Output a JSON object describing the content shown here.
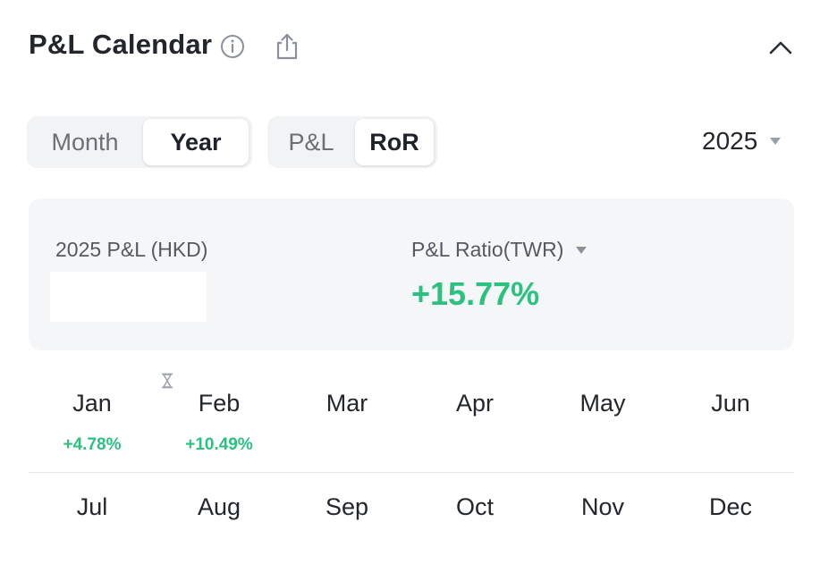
{
  "header": {
    "title": "P&L Calendar",
    "icons": {
      "info": "info-icon",
      "share": "share-icon",
      "collapse": "chevron-up-icon"
    }
  },
  "period_toggle": {
    "options": [
      "Month",
      "Year"
    ],
    "selected": "Year"
  },
  "metric_toggle": {
    "options": [
      "P&L",
      "RoR"
    ],
    "selected": "RoR"
  },
  "year_select": {
    "value": "2025"
  },
  "summary": {
    "pl_label": "2025 P&L (HKD)",
    "ratio_label": "P&L Ratio(TWR)",
    "ratio_value": "+15.77%"
  },
  "months": [
    {
      "name": "Jan",
      "value": "+4.78%"
    },
    {
      "name": "Feb",
      "value": "+10.49%",
      "icon": "hourglass-icon"
    },
    {
      "name": "Mar",
      "value": ""
    },
    {
      "name": "Apr",
      "value": ""
    },
    {
      "name": "May",
      "value": ""
    },
    {
      "name": "Jun",
      "value": ""
    },
    {
      "name": "Jul",
      "value": ""
    },
    {
      "name": "Aug",
      "value": ""
    },
    {
      "name": "Sep",
      "value": ""
    },
    {
      "name": "Oct",
      "value": ""
    },
    {
      "name": "Nov",
      "value": ""
    },
    {
      "name": "Dec",
      "value": ""
    }
  ],
  "colors": {
    "positive": "#29c27f",
    "text": "#23262b",
    "muted": "#6b6f76",
    "panel": "#f5f6f7"
  }
}
